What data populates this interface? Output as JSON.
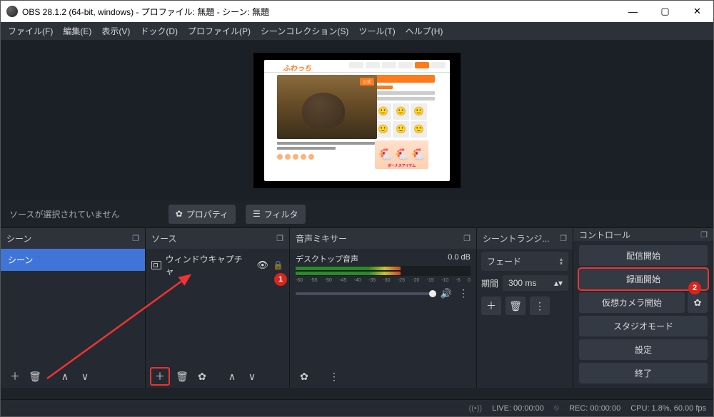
{
  "window": {
    "title": "OBS 28.1.2 (64-bit, windows) - プロファイル: 無題 - シーン: 無題"
  },
  "menu": {
    "file": "ファイル(F)",
    "edit": "編集(E)",
    "view": "表示(V)",
    "dock": "ドック(D)",
    "profile": "プロファイル(P)",
    "sceneCollection": "シーンコレクション(S)",
    "tools": "ツール(T)",
    "help": "ヘルプ(H)"
  },
  "preview": {
    "site_logo": "ふわっち",
    "image_tag": "公式"
  },
  "srcToolbar": {
    "noSource": "ソースが選択されていません",
    "properties": "プロパティ",
    "filters": "フィルタ"
  },
  "panels": {
    "scenes": {
      "title": "シーン",
      "item": "シーン"
    },
    "sources": {
      "title": "ソース",
      "item": "ウィンドウキャプチャ"
    },
    "mixer": {
      "title": "音声ミキサー",
      "track": "デスクトップ音声",
      "db": "0.0 dB",
      "ticks": [
        "-60",
        "-55",
        "-50",
        "-45",
        "-40",
        "-35",
        "-30",
        "-25",
        "-20",
        "-15",
        "-10",
        "-5",
        "0"
      ]
    },
    "transitions": {
      "title": "シーントランジ...",
      "type": "フェード",
      "durationLabel": "期間",
      "durationValue": "300 ms"
    },
    "controls": {
      "title": "コントロール",
      "startStream": "配信開始",
      "startRecord": "録画開始",
      "startVcam": "仮想カメラ開始",
      "studio": "スタジオモード",
      "settings": "設定",
      "exit": "終了"
    }
  },
  "annotations": {
    "one": "1",
    "two": "2"
  },
  "status": {
    "live": "LIVE: 00:00:00",
    "rec": "REC: 00:00:00",
    "cpu": "CPU: 1.8%, 60.00 fps"
  }
}
